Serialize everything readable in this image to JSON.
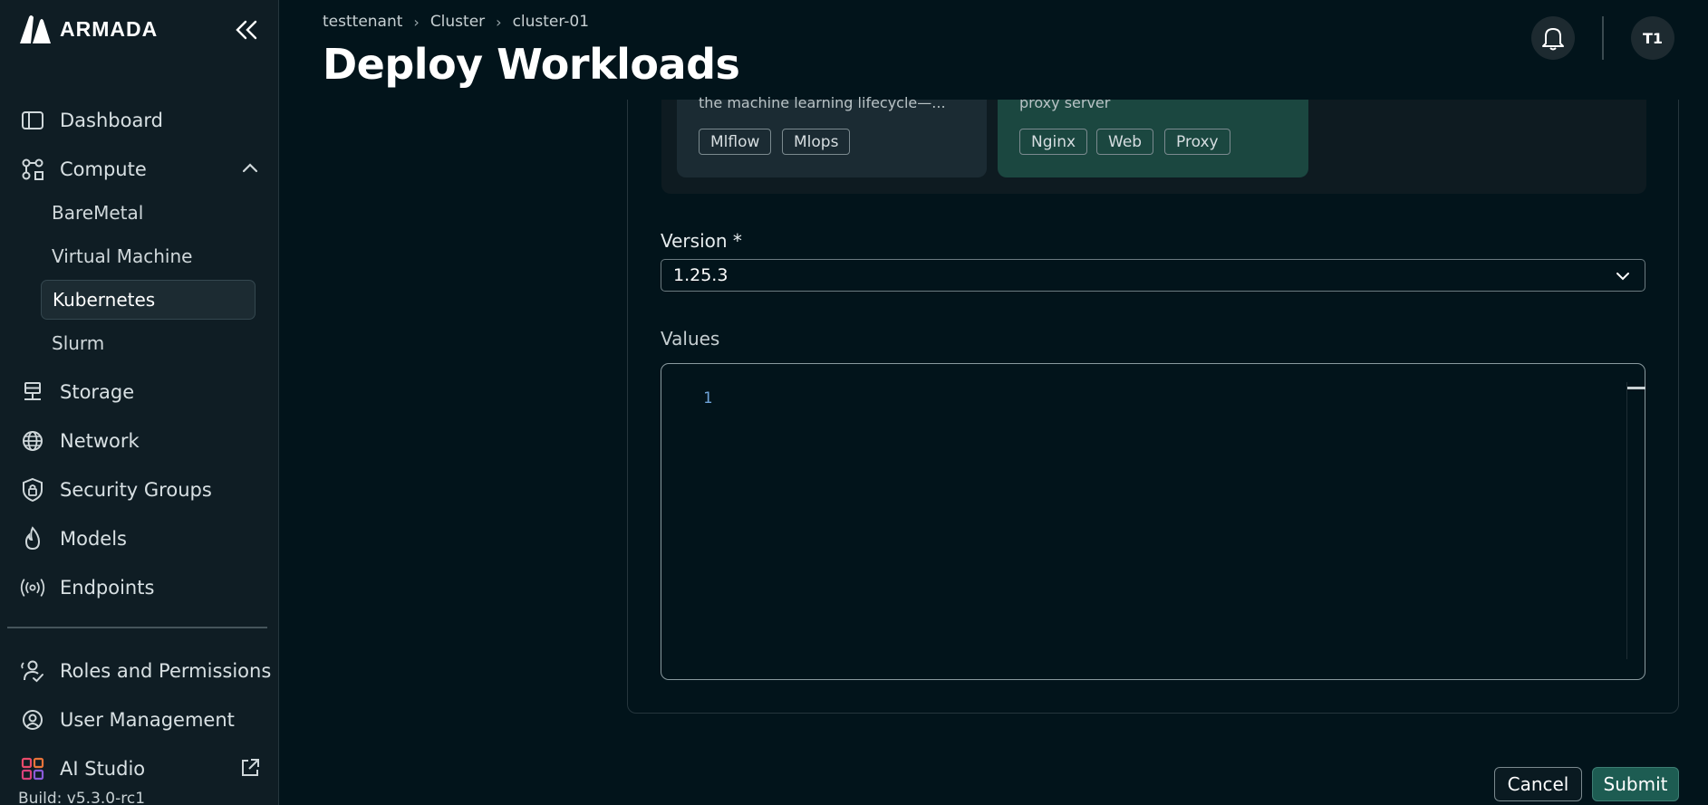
{
  "brand": {
    "name": "ARMADA"
  },
  "sidebar": {
    "items": [
      {
        "label": "Dashboard",
        "icon": "dashboard-icon"
      },
      {
        "label": "Compute",
        "icon": "compute-icon"
      },
      {
        "label": "Storage",
        "icon": "storage-icon"
      },
      {
        "label": "Network",
        "icon": "globe-icon"
      },
      {
        "label": "Security Groups",
        "icon": "shield-lock-icon"
      },
      {
        "label": "Models",
        "icon": "flame-icon"
      },
      {
        "label": "Endpoints",
        "icon": "broadcast-icon"
      },
      {
        "label": "Roles and Permissions",
        "icon": "users-check-icon"
      },
      {
        "label": "User Management",
        "icon": "user-circle-icon"
      },
      {
        "label": "AI Studio",
        "icon": "ai-studio-icon"
      }
    ],
    "compute_sub": [
      {
        "label": "BareMetal"
      },
      {
        "label": "Virtual Machine"
      },
      {
        "label": "Kubernetes",
        "active": true
      },
      {
        "label": "Slurm"
      }
    ],
    "build": "Build: v5.3.0-rc1"
  },
  "header": {
    "breadcrumb": [
      "testtenant",
      "Cluster",
      "cluster-01"
    ],
    "title": "Deploy Workloads",
    "avatar": "T1"
  },
  "cards": [
    {
      "description": "the machine learning lifecycle—...",
      "tags": [
        "Mlflow",
        "Mlops"
      ]
    },
    {
      "description": "proxy server",
      "tags": [
        "Nginx",
        "Web",
        "Proxy"
      ]
    }
  ],
  "form": {
    "version_label": "Version *",
    "version_value": "1.25.3",
    "values_label": "Values",
    "editor_line": "1"
  },
  "actions": {
    "cancel": "Cancel",
    "submit": "Submit"
  },
  "colors": {
    "accent": "#1d5c52",
    "background": "#02141b",
    "sidebar": "#0f1d24"
  }
}
